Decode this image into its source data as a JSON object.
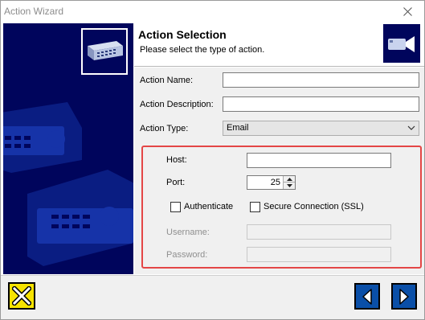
{
  "window": {
    "title": "Action Wizard"
  },
  "header": {
    "title": "Action Selection",
    "subtitle": "Please select the type of action.",
    "icon": "camera-icon"
  },
  "form": {
    "action_name_label": "Action Name:",
    "action_name_value": "",
    "action_description_label": "Action Description:",
    "action_description_value": "",
    "action_type_label": "Action Type:",
    "action_type_value": "Email"
  },
  "email": {
    "host_label": "Host:",
    "host_value": "",
    "port_label": "Port:",
    "port_value": "25",
    "authenticate_label": "Authenticate",
    "authenticate_checked": false,
    "ssl_label": "Secure Connection (SSL)",
    "ssl_checked": false,
    "username_label": "Username:",
    "username_value": "",
    "password_label": "Password:",
    "password_value": ""
  },
  "colors": {
    "side_panel": "#00055c",
    "highlight_border": "#e44646",
    "cancel_button": "#f7e300",
    "nav_button": "#0a4fa8"
  },
  "footer": {
    "cancel_icon": "close-x-icon",
    "back_icon": "arrow-left-icon",
    "next_icon": "arrow-right-icon"
  }
}
